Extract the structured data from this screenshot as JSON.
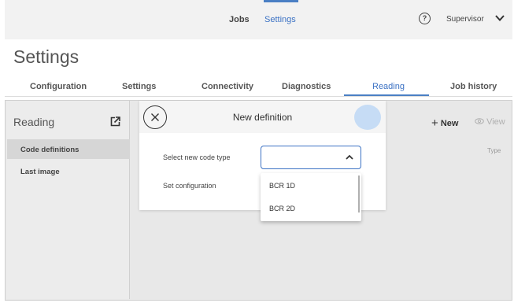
{
  "topnav": {
    "jobs": "Jobs",
    "settings": "Settings",
    "help_icon": "question-circle-icon",
    "user": "Supervisor",
    "accent_color": "#3c72c4"
  },
  "page": {
    "title": "Settings",
    "tabs": [
      {
        "label": "Configuration"
      },
      {
        "label": "Settings"
      },
      {
        "label": "Connectivity"
      },
      {
        "label": "Diagnostics"
      },
      {
        "label": "Reading",
        "active": true
      },
      {
        "label": "Job history"
      }
    ]
  },
  "sidebar": {
    "title": "Reading",
    "items": [
      {
        "label": "Code definitions",
        "selected": true
      },
      {
        "label": "Last image"
      }
    ]
  },
  "toolbar": {
    "new_label": "New",
    "view_label": "View"
  },
  "table": {
    "type_column": "Type"
  },
  "modal": {
    "title": "New definition",
    "select_label": "Select new code type",
    "select_value": "",
    "config_label": "Set configuration",
    "options": [
      "BCR 1D",
      "BCR 2D"
    ]
  }
}
